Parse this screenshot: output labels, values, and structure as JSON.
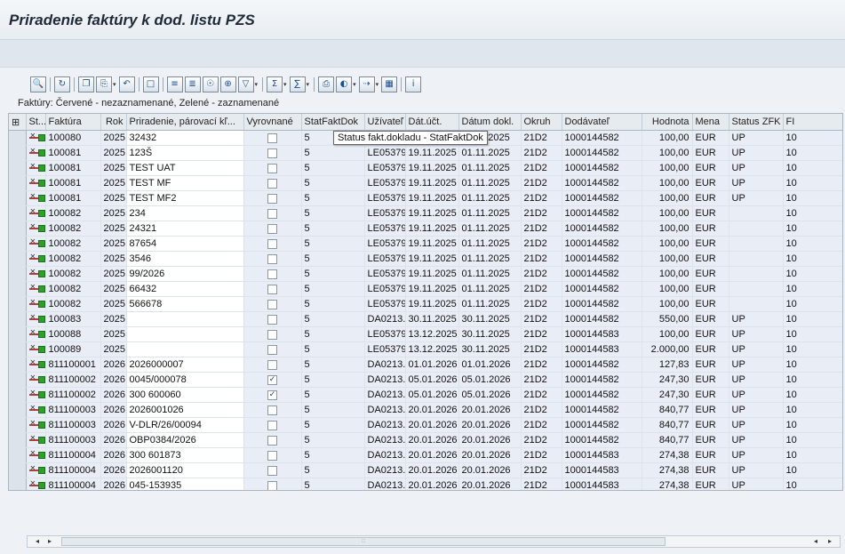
{
  "title": "Priradenie faktúry k dod. listu PZS",
  "caption": "Faktúry: Červené - nezaznamenané, Zelené - zaznamenané",
  "tooltip": "Status fakt.dokladu - StatFaktDok",
  "toolbar": [
    "details-icon",
    "refresh-icon",
    "copy-icon",
    "paste-icon",
    "undo-icon",
    "split-icon",
    "sort-ascending-icon",
    "sort-descending-icon",
    "find-icon",
    "find-next-icon",
    "filter-icon",
    "sum-icon",
    "subtotal-icon",
    "print-icon",
    "views-icon",
    "export-icon",
    "layout-icon",
    "info-icon"
  ],
  "columns": [
    "St...",
    "Faktúra",
    "Rok",
    "Priradenie, párovací kľ...",
    "Vyrovnané",
    "StatFaktDok",
    "Užívateľ",
    "Dát.účt.",
    "Dátum dokl.",
    "Okruh",
    "Dodávateľ",
    "Hodnota",
    "Mena",
    "Status ZFK",
    "FI"
  ],
  "rows": [
    {
      "faktura": "100080",
      "rok": "2025",
      "prir": "32432",
      "vyr": false,
      "stat": "5",
      "uziv": "LE053797",
      "datuct": "19.11.2025",
      "datdokl": "01.11.2025",
      "okruh": "21D2",
      "dod": "1000144582",
      "hodnota": "100,00",
      "mena": "EUR",
      "zfk": "UP",
      "fi": "10"
    },
    {
      "faktura": "100081",
      "rok": "2025",
      "prir": "123Š",
      "vyr": false,
      "stat": "5",
      "uziv": "LE053797",
      "datuct": "19.11.2025",
      "datdokl": "01.11.2025",
      "okruh": "21D2",
      "dod": "1000144582",
      "hodnota": "100,00",
      "mena": "EUR",
      "zfk": "UP",
      "fi": "10"
    },
    {
      "faktura": "100081",
      "rok": "2025",
      "prir": "TEST UAT",
      "vyr": false,
      "stat": "5",
      "uziv": "LE053797",
      "datuct": "19.11.2025",
      "datdokl": "01.11.2025",
      "okruh": "21D2",
      "dod": "1000144582",
      "hodnota": "100,00",
      "mena": "EUR",
      "zfk": "UP",
      "fi": "10"
    },
    {
      "faktura": "100081",
      "rok": "2025",
      "prir": "TEST MF",
      "vyr": false,
      "stat": "5",
      "uziv": "LE053797",
      "datuct": "19.11.2025",
      "datdokl": "01.11.2025",
      "okruh": "21D2",
      "dod": "1000144582",
      "hodnota": "100,00",
      "mena": "EUR",
      "zfk": "UP",
      "fi": "10"
    },
    {
      "faktura": "100081",
      "rok": "2025",
      "prir": "TEST MF2",
      "vyr": false,
      "stat": "5",
      "uziv": "LE053797",
      "datuct": "19.11.2025",
      "datdokl": "01.11.2025",
      "okruh": "21D2",
      "dod": "1000144582",
      "hodnota": "100,00",
      "mena": "EUR",
      "zfk": "UP",
      "fi": "10"
    },
    {
      "faktura": "100082",
      "rok": "2025",
      "prir": "234",
      "vyr": false,
      "stat": "5",
      "uziv": "LE053797",
      "datuct": "19.11.2025",
      "datdokl": "01.11.2025",
      "okruh": "21D2",
      "dod": "1000144582",
      "hodnota": "100,00",
      "mena": "EUR",
      "zfk": "",
      "fi": "10"
    },
    {
      "faktura": "100082",
      "rok": "2025",
      "prir": "24321",
      "vyr": false,
      "stat": "5",
      "uziv": "LE053797",
      "datuct": "19.11.2025",
      "datdokl": "01.11.2025",
      "okruh": "21D2",
      "dod": "1000144582",
      "hodnota": "100,00",
      "mena": "EUR",
      "zfk": "",
      "fi": "10"
    },
    {
      "faktura": "100082",
      "rok": "2025",
      "prir": "87654",
      "vyr": false,
      "stat": "5",
      "uziv": "LE053797",
      "datuct": "19.11.2025",
      "datdokl": "01.11.2025",
      "okruh": "21D2",
      "dod": "1000144582",
      "hodnota": "100,00",
      "mena": "EUR",
      "zfk": "",
      "fi": "10"
    },
    {
      "faktura": "100082",
      "rok": "2025",
      "prir": "3546",
      "vyr": false,
      "stat": "5",
      "uziv": "LE053797",
      "datuct": "19.11.2025",
      "datdokl": "01.11.2025",
      "okruh": "21D2",
      "dod": "1000144582",
      "hodnota": "100,00",
      "mena": "EUR",
      "zfk": "",
      "fi": "10"
    },
    {
      "faktura": "100082",
      "rok": "2025",
      "prir": "99/2026",
      "vyr": false,
      "stat": "5",
      "uziv": "LE053797",
      "datuct": "19.11.2025",
      "datdokl": "01.11.2025",
      "okruh": "21D2",
      "dod": "1000144582",
      "hodnota": "100,00",
      "mena": "EUR",
      "zfk": "",
      "fi": "10"
    },
    {
      "faktura": "100082",
      "rok": "2025",
      "prir": "66432",
      "vyr": false,
      "stat": "5",
      "uziv": "LE053797",
      "datuct": "19.11.2025",
      "datdokl": "01.11.2025",
      "okruh": "21D2",
      "dod": "1000144582",
      "hodnota": "100,00",
      "mena": "EUR",
      "zfk": "",
      "fi": "10"
    },
    {
      "faktura": "100082",
      "rok": "2025",
      "prir": "566678",
      "vyr": false,
      "stat": "5",
      "uziv": "LE053797",
      "datuct": "19.11.2025",
      "datdokl": "01.11.2025",
      "okruh": "21D2",
      "dod": "1000144582",
      "hodnota": "100,00",
      "mena": "EUR",
      "zfk": "",
      "fi": "10"
    },
    {
      "faktura": "100083",
      "rok": "2025",
      "prir": "",
      "vyr": false,
      "stat": "5",
      "uziv": "DA0213...",
      "datuct": "30.11.2025",
      "datdokl": "30.11.2025",
      "okruh": "21D2",
      "dod": "1000144582",
      "hodnota": "550,00",
      "mena": "EUR",
      "zfk": "UP",
      "fi": "10"
    },
    {
      "faktura": "100088",
      "rok": "2025",
      "prir": "",
      "vyr": false,
      "stat": "5",
      "uziv": "LE053797",
      "datuct": "13.12.2025",
      "datdokl": "30.11.2025",
      "okruh": "21D2",
      "dod": "1000144583",
      "hodnota": "100,00",
      "mena": "EUR",
      "zfk": "UP",
      "fi": "10"
    },
    {
      "faktura": "100089",
      "rok": "2025",
      "prir": "",
      "vyr": false,
      "stat": "5",
      "uziv": "LE053797",
      "datuct": "13.12.2025",
      "datdokl": "30.11.2025",
      "okruh": "21D2",
      "dod": "1000144583",
      "hodnota": "2.000,00",
      "mena": "EUR",
      "zfk": "UP",
      "fi": "10"
    },
    {
      "faktura": "811100001",
      "rok": "2026",
      "prir": "2026000007",
      "vyr": false,
      "stat": "5",
      "uziv": "DA0213...",
      "datuct": "01.01.2026",
      "datdokl": "01.01.2026",
      "okruh": "21D2",
      "dod": "1000144582",
      "hodnota": "127,83",
      "mena": "EUR",
      "zfk": "UP",
      "fi": "10"
    },
    {
      "faktura": "811100002",
      "rok": "2026",
      "prir": "0045/000078",
      "vyr": true,
      "stat": "5",
      "uziv": "DA0213...",
      "datuct": "05.01.2026",
      "datdokl": "05.01.2026",
      "okruh": "21D2",
      "dod": "1000144582",
      "hodnota": "247,30",
      "mena": "EUR",
      "zfk": "UP",
      "fi": "10"
    },
    {
      "faktura": "811100002",
      "rok": "2026",
      "prir": "300 600060",
      "vyr": true,
      "stat": "5",
      "uziv": "DA0213...",
      "datuct": "05.01.2026",
      "datdokl": "05.01.2026",
      "okruh": "21D2",
      "dod": "1000144582",
      "hodnota": "247,30",
      "mena": "EUR",
      "zfk": "UP",
      "fi": "10"
    },
    {
      "faktura": "811100003",
      "rok": "2026",
      "prir": "2026001026",
      "vyr": false,
      "stat": "5",
      "uziv": "DA0213...",
      "datuct": "20.01.2026",
      "datdokl": "20.01.2026",
      "okruh": "21D2",
      "dod": "1000144582",
      "hodnota": "840,77",
      "mena": "EUR",
      "zfk": "UP",
      "fi": "10"
    },
    {
      "faktura": "811100003",
      "rok": "2026",
      "prir": "V-DLR/26/00094",
      "vyr": false,
      "stat": "5",
      "uziv": "DA0213...",
      "datuct": "20.01.2026",
      "datdokl": "20.01.2026",
      "okruh": "21D2",
      "dod": "1000144582",
      "hodnota": "840,77",
      "mena": "EUR",
      "zfk": "UP",
      "fi": "10"
    },
    {
      "faktura": "811100003",
      "rok": "2026",
      "prir": "OBP0384/2026",
      "vyr": false,
      "stat": "5",
      "uziv": "DA0213...",
      "datuct": "20.01.2026",
      "datdokl": "20.01.2026",
      "okruh": "21D2",
      "dod": "1000144582",
      "hodnota": "840,77",
      "mena": "EUR",
      "zfk": "UP",
      "fi": "10"
    },
    {
      "faktura": "811100004",
      "rok": "2026",
      "prir": "300  601873",
      "vyr": false,
      "stat": "5",
      "uziv": "DA0213...",
      "datuct": "20.01.2026",
      "datdokl": "20.01.2026",
      "okruh": "21D2",
      "dod": "1000144583",
      "hodnota": "274,38",
      "mena": "EUR",
      "zfk": "UP",
      "fi": "10"
    },
    {
      "faktura": "811100004",
      "rok": "2026",
      "prir": "2026001120",
      "vyr": false,
      "stat": "5",
      "uziv": "DA0213...",
      "datuct": "20.01.2026",
      "datdokl": "20.01.2026",
      "okruh": "21D2",
      "dod": "1000144583",
      "hodnota": "274,38",
      "mena": "EUR",
      "zfk": "UP",
      "fi": "10"
    },
    {
      "faktura": "811100004",
      "rok": "2026",
      "prir": "045-153935",
      "vyr": false,
      "stat": "5",
      "uziv": "DA0213...",
      "datuct": "20.01.2026",
      "datdokl": "20.01.2026",
      "okruh": "21D2",
      "dod": "1000144583",
      "hodnota": "274,38",
      "mena": "EUR",
      "zfk": "UP",
      "fi": "10"
    }
  ]
}
